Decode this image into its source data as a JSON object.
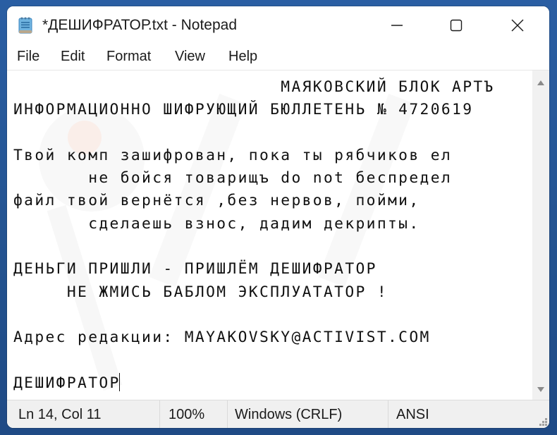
{
  "window": {
    "title": "*ДЕШИФРАТОР.txt - Notepad",
    "app_icon": "notepad-icon",
    "controls": {
      "minimize": "minimize-icon",
      "maximize": "maximize-icon",
      "close": "close-icon"
    }
  },
  "menu": {
    "items": [
      {
        "label": "File"
      },
      {
        "label": "Edit"
      },
      {
        "label": "Format"
      },
      {
        "label": "View"
      },
      {
        "label": "Help"
      }
    ]
  },
  "editor": {
    "content": "                         МАЯКОВСКИЙ БЛОК АРТЪ\nИНФОРМАЦИОННО ШИФРУЮЩИЙ БЮЛЛЕТЕНЬ № 4720619\n\nТвой комп зашифрован, пока ты рябчиков ел\n       не бойся товарищъ do not беспредел\nфайл твой вернётся ,без нервов, пойми,\n       сделаешь взнос, дадим декрипты.\n\nДЕНЬГИ ПРИШЛИ - ПРИШЛЁМ ДЕШИФРАТОР\n     НЕ ЖМИСЬ БАБЛОМ ЭКСПЛУАТАТОР !\n\nАдрес редакции: MAYAKOVSKY@ACTIVIST.COM\n\nДЕШИФРАТОР"
  },
  "status": {
    "position": "Ln 14, Col 11",
    "zoom": "100%",
    "line_ending": "Windows (CRLF)",
    "encoding": "ANSI"
  },
  "colors": {
    "desktop": "#23528f",
    "window_bg": "#ffffff",
    "statusbar_bg": "#f0f0f0",
    "text": "#111111"
  }
}
